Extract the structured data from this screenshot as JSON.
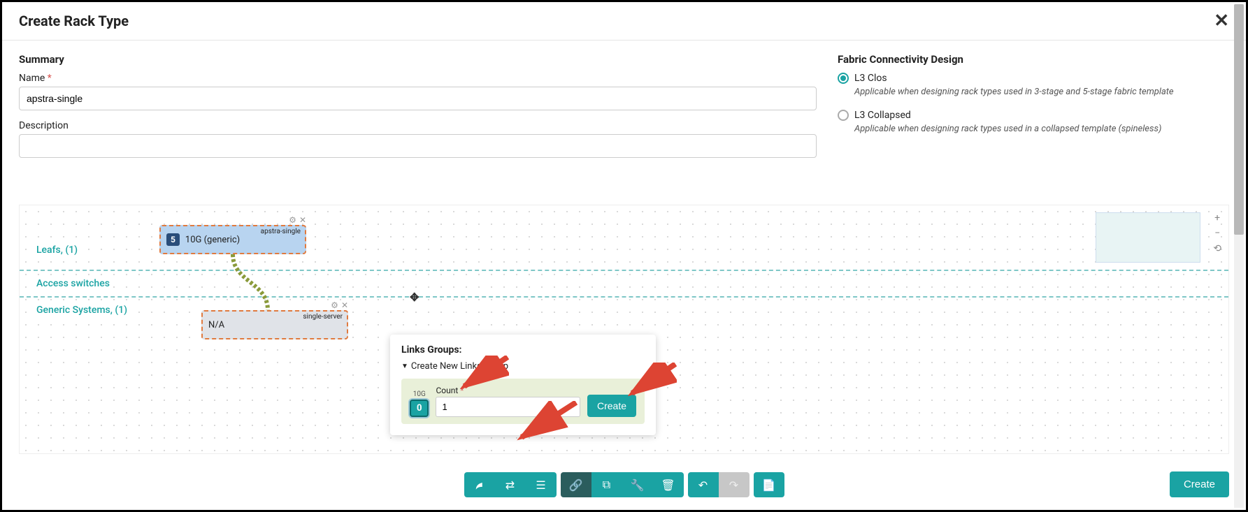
{
  "header": {
    "title": "Create Rack Type"
  },
  "summary": {
    "heading": "Summary",
    "name_label": "Name",
    "name_value": "apstra-single",
    "desc_label": "Description",
    "desc_value": ""
  },
  "fabric": {
    "heading": "Fabric Connectivity Design",
    "options": [
      {
        "label": "L3 Clos",
        "desc": "Applicable when designing rack types used in 3-stage and 5-stage fabric template",
        "selected": true
      },
      {
        "label": "L3 Collapsed",
        "desc": "Applicable when designing rack types used in a collapsed template (spineless)",
        "selected": false
      }
    ]
  },
  "canvas": {
    "layers": {
      "leafs": "Leafs, (1)",
      "access": "Access switches",
      "generic": "Generic Systems, (1)"
    },
    "leaf_node": {
      "count": "5",
      "title": "apstra-single",
      "subtitle": "10G (generic)"
    },
    "gs_node": {
      "title": "single-server",
      "subtitle": "N/A"
    }
  },
  "popup": {
    "title": "Links Groups:",
    "section": "Create New Links Group",
    "speed_label": "10G",
    "speed_value": "0",
    "count_label": "Count",
    "count_value": "1",
    "create_label": "Create"
  },
  "toolbar": {
    "icons": {
      "leaf": "leaf",
      "swap": "swap",
      "list": "list",
      "link": "link",
      "copy": "copy",
      "wrench": "wrench",
      "trash": "trash",
      "undo": "undo",
      "redo": "redo",
      "doc": "doc"
    }
  },
  "footer": {
    "create_label": "Create"
  }
}
